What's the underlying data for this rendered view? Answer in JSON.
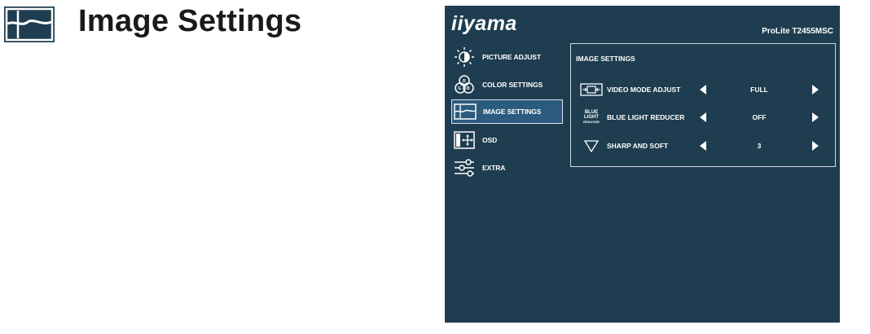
{
  "header": {
    "title": "Image Settings",
    "icon": "image-settings-icon"
  },
  "osd": {
    "brand": "iiyama",
    "model": "ProLite T2455MSC",
    "colors": {
      "background": "#1f3d50",
      "selected": "#2b5b7f"
    },
    "menu": [
      {
        "label": "PICTURE ADJUST",
        "icon": "picture-adjust-icon",
        "selected": false
      },
      {
        "label": "COLOR SETTINGS",
        "icon": "color-settings-icon",
        "selected": false
      },
      {
        "label": "IMAGE SETTINGS",
        "icon": "image-settings-icon",
        "selected": true
      },
      {
        "label": "OSD",
        "icon": "osd-icon",
        "selected": false
      },
      {
        "label": "EXTRA",
        "icon": "extra-icon",
        "selected": false
      }
    ],
    "panel": {
      "title": "IMAGE SETTINGS",
      "rows": [
        {
          "label": "VIDEO MODE ADJUST",
          "value": "FULL",
          "icon": "video-mode-icon"
        },
        {
          "label": "BLUE LIGHT REDUCER",
          "value": "OFF",
          "icon": "blue-light-icon",
          "icon_text": [
            "BLUE",
            "LIGHT",
            "REDUCER"
          ]
        },
        {
          "label": "SHARP AND SOFT",
          "value": "3",
          "icon": "sharpness-icon"
        }
      ]
    }
  }
}
